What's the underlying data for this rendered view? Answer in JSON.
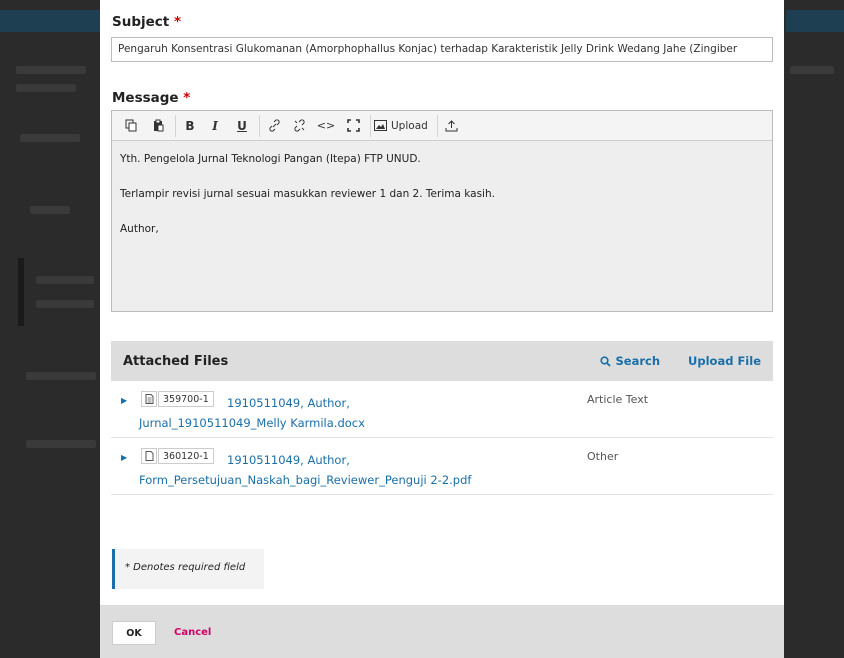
{
  "subject": {
    "label": "Subject",
    "value": "Pengaruh Konsentrasi Glukomanan (Amorphophallus Konjac) terhadap Karakteristik Jelly Drink Wedang Jahe (Zingiber"
  },
  "required_mark": "*",
  "message": {
    "label": "Message",
    "toolbar": {
      "upload_label": "Upload",
      "icons": [
        "copy-icon",
        "paste-icon",
        "bold-icon",
        "italic-icon",
        "underline-icon",
        "link-icon",
        "unlink-icon",
        "code-icon",
        "fullscreen-icon",
        "image-upload-icon",
        "file-upload-icon"
      ]
    },
    "paragraphs": [
      "Yth. Pengelola Jurnal Teknologi Pangan (Itepa) FTP UNUD.",
      "Terlampir revisi jurnal sesuai masukkan reviewer 1 dan 2. Terima kasih.",
      "Author,"
    ]
  },
  "attached_files": {
    "title": "Attached Files",
    "search_label": "Search",
    "upload_label": "Upload File",
    "rows": [
      {
        "id": "359700-1",
        "name": "1910511049, Author, Jurnal_1910511049_Melly Karmila.docx",
        "category": "Article Text"
      },
      {
        "id": "360120-1",
        "name": "1910511049, Author, Form_Persetujuan_Naskah_bagi_Reviewer_Penguji 2-2.pdf",
        "category": "Other"
      }
    ]
  },
  "note": "* Denotes required field",
  "footer": {
    "ok_label": "OK",
    "cancel_label": "Cancel"
  }
}
